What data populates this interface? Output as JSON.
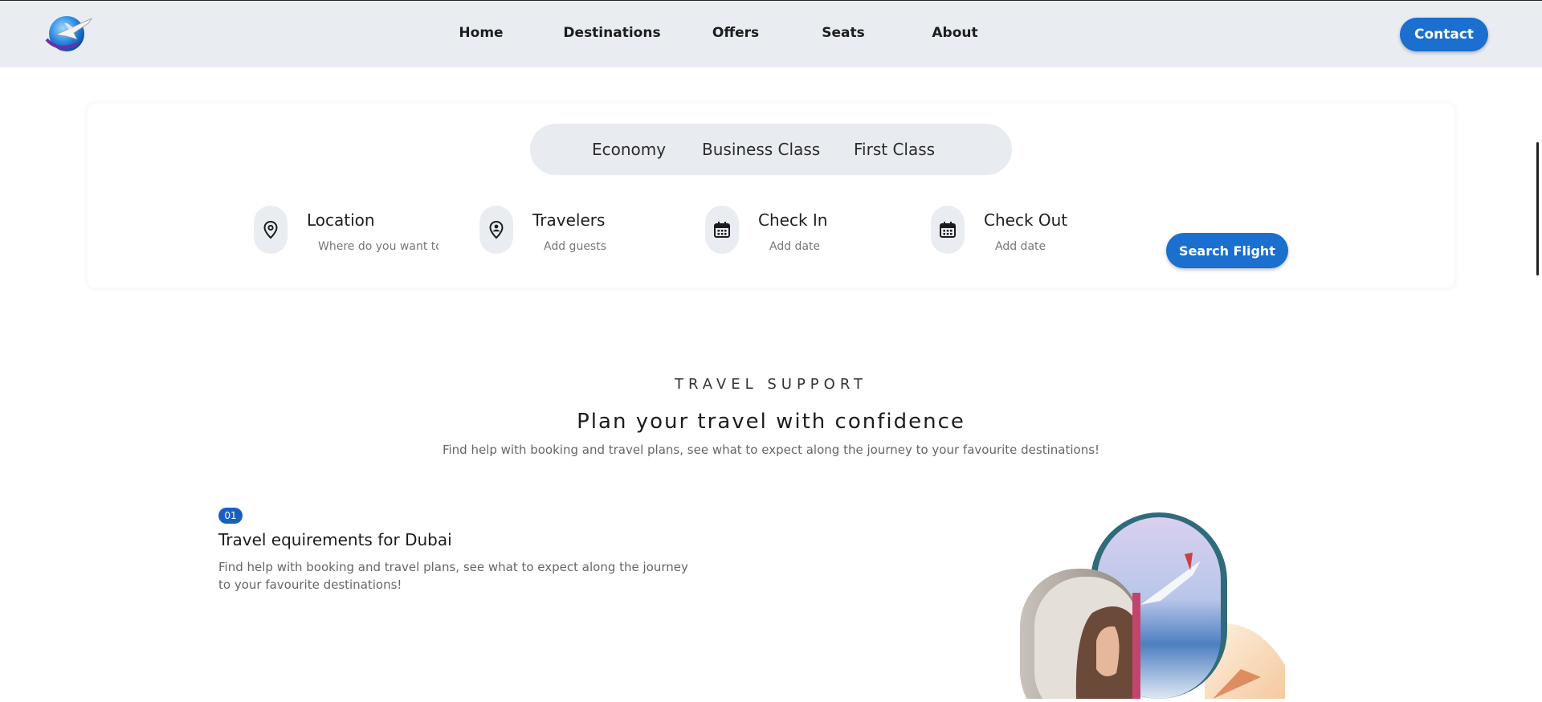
{
  "nav": {
    "items": [
      {
        "label": "Home"
      },
      {
        "label": "Destinations"
      },
      {
        "label": "Offers"
      },
      {
        "label": "Seats"
      },
      {
        "label": "About"
      }
    ],
    "contact_label": "Contact"
  },
  "search": {
    "classes": [
      "Economy",
      "Business Class",
      "First Class"
    ],
    "fields": [
      {
        "title": "Location",
        "placeholder": "Where do you want to go?",
        "icon": "location-pin-icon"
      },
      {
        "title": "Travelers",
        "placeholder": "Add guests",
        "icon": "user-pin-icon"
      },
      {
        "title": "Check In",
        "placeholder": "Add date",
        "icon": "calendar-icon"
      },
      {
        "title": "Check Out",
        "placeholder": "Add date",
        "icon": "calendar-icon"
      }
    ],
    "button_label": "Search Flight"
  },
  "support": {
    "eyebrow": "TRAVEL SUPPORT",
    "title": "Plan your travel with confidence",
    "subtitle": "Find help with booking and travel plans, see what to expect along the journey to your favourite destinations!",
    "items": [
      {
        "number": "01",
        "title": "Travel equirements for Dubai",
        "description": "Find help with booking and travel plans, see what to expect along the journey to your favourite destinations!"
      }
    ]
  },
  "colors": {
    "accent": "#1a6fcf",
    "navbar_bg": "#e9edf2",
    "badge": "#1a5fc0"
  }
}
